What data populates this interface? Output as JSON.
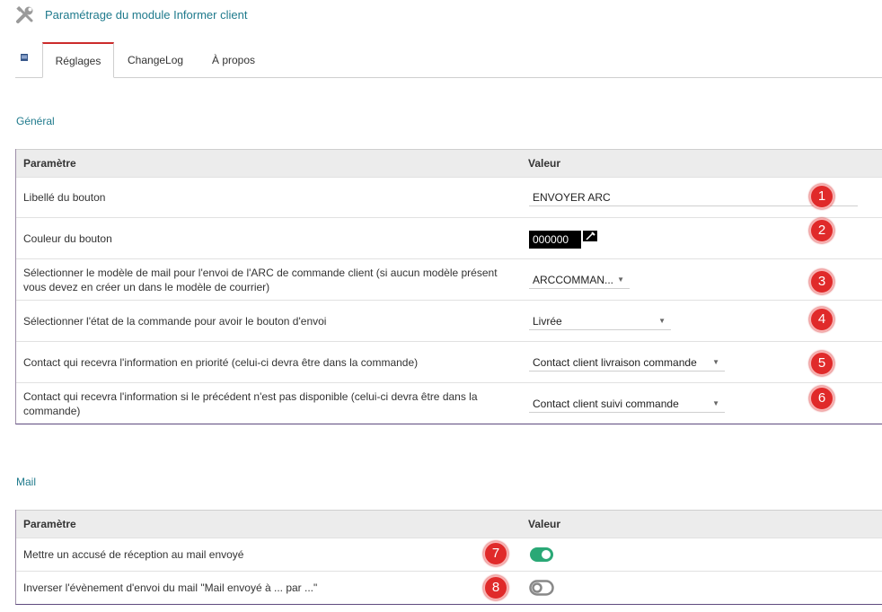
{
  "header": {
    "title": "Paramétrage du module Informer client",
    "icon": "tools-icon"
  },
  "tabs": [
    {
      "label": "Réglages",
      "active": true
    },
    {
      "label": "ChangeLog",
      "active": false
    },
    {
      "label": "À propos",
      "active": false
    }
  ],
  "general": {
    "section_title": "Général",
    "col_param": "Paramètre",
    "col_value": "Valeur",
    "rows": [
      {
        "label": "Libellé du bouton",
        "value": "ENVOYER ARC",
        "badge": "1"
      },
      {
        "label": "Couleur du bouton",
        "value": "000000",
        "badge": "2"
      },
      {
        "label": "Sélectionner le modèle de mail pour l'envoi de l'ARC de commande client (si aucun modèle présent vous devez en créer un dans le modèle de courrier)",
        "value": "ARCCOMMAN...",
        "badge": "3"
      },
      {
        "label": "Sélectionner l'état de la commande pour avoir le bouton d'envoi",
        "value": "Livrée",
        "badge": "4"
      },
      {
        "label": "Contact qui recevra l'information en priorité (celui-ci devra être dans la commande)",
        "value": "Contact client livraison commande",
        "badge": "5"
      },
      {
        "label": "Contact qui recevra l'information si le précédent n'est pas disponible (celui-ci devra être dans la commande)",
        "value": "Contact client suivi commande",
        "badge": "6"
      }
    ]
  },
  "mail": {
    "section_title": "Mail",
    "col_param": "Paramètre",
    "col_value": "Valeur",
    "rows": [
      {
        "label": "Mettre un accusé de réception au mail envoyé",
        "on": true,
        "badge": "7"
      },
      {
        "label": "Inverser l'évènement d'envoi du mail \"Mail envoyé à ... par ...\"",
        "on": false,
        "badge": "8"
      }
    ]
  },
  "colors": {
    "accent": "#1f7a8c",
    "tab_active_border": "#cc2b2b",
    "badge": "#e02a2a",
    "toggle_on": "#2aa876",
    "toggle_off": "#888888"
  }
}
